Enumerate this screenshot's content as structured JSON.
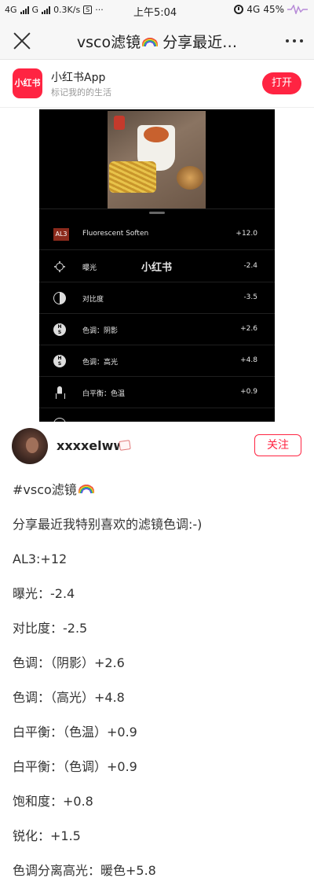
{
  "status_bar": {
    "network_1": "4G",
    "network_2": "G",
    "speed": "0.3K/s",
    "sim_icon": "S",
    "dots": "···",
    "time": "上午5:04",
    "network_right": "4G",
    "battery": "45%"
  },
  "title_bar": {
    "title": "vsco滤镜",
    "title_suffix": "分享最近…"
  },
  "app_banner": {
    "name": "小红书App",
    "slogan": "标记我的的生活",
    "logo_text": "小红书",
    "open_label": "打开"
  },
  "post_image": {
    "watermark": "小红书",
    "adjustments": [
      {
        "icon": "al3-preset-icon",
        "badge": "AL3",
        "label": "Fluorescent Soften",
        "value": "+12.0"
      },
      {
        "icon": "exposure-sun-icon",
        "label": "曝光",
        "value": "-2.4"
      },
      {
        "icon": "contrast-icon",
        "label": "对比度",
        "value": "-3.5"
      },
      {
        "icon": "hsl-icon",
        "label": "色调：阴影",
        "value": "+2.6"
      },
      {
        "icon": "hsl-icon",
        "label": "色调：高光",
        "value": "+4.8"
      },
      {
        "icon": "white-balance-icon",
        "label": "白平衡：色温",
        "value": "+0.9"
      }
    ]
  },
  "author": {
    "name": "xxxxelww",
    "follow_label": "关注"
  },
  "post": {
    "lines": [
      "#vsco滤镜",
      "分享最近我特别喜欢的滤镜色调:-)",
      "AL3:+12",
      "曝光：-2.4",
      "对比度：-2.5",
      "色调：（阴影）+2.6",
      "色调：（高光）+4.8",
      "白平衡：（色温）+0.9",
      "白平衡：（色调）+0.9",
      "饱和度：+0.8",
      "锐化：+1.5",
      "色调分离高光：暖色+5.8"
    ]
  },
  "colors": {
    "brand_red": "#ff2442",
    "status_bg": "#f7f7f7",
    "editor_bg": "#000000"
  }
}
